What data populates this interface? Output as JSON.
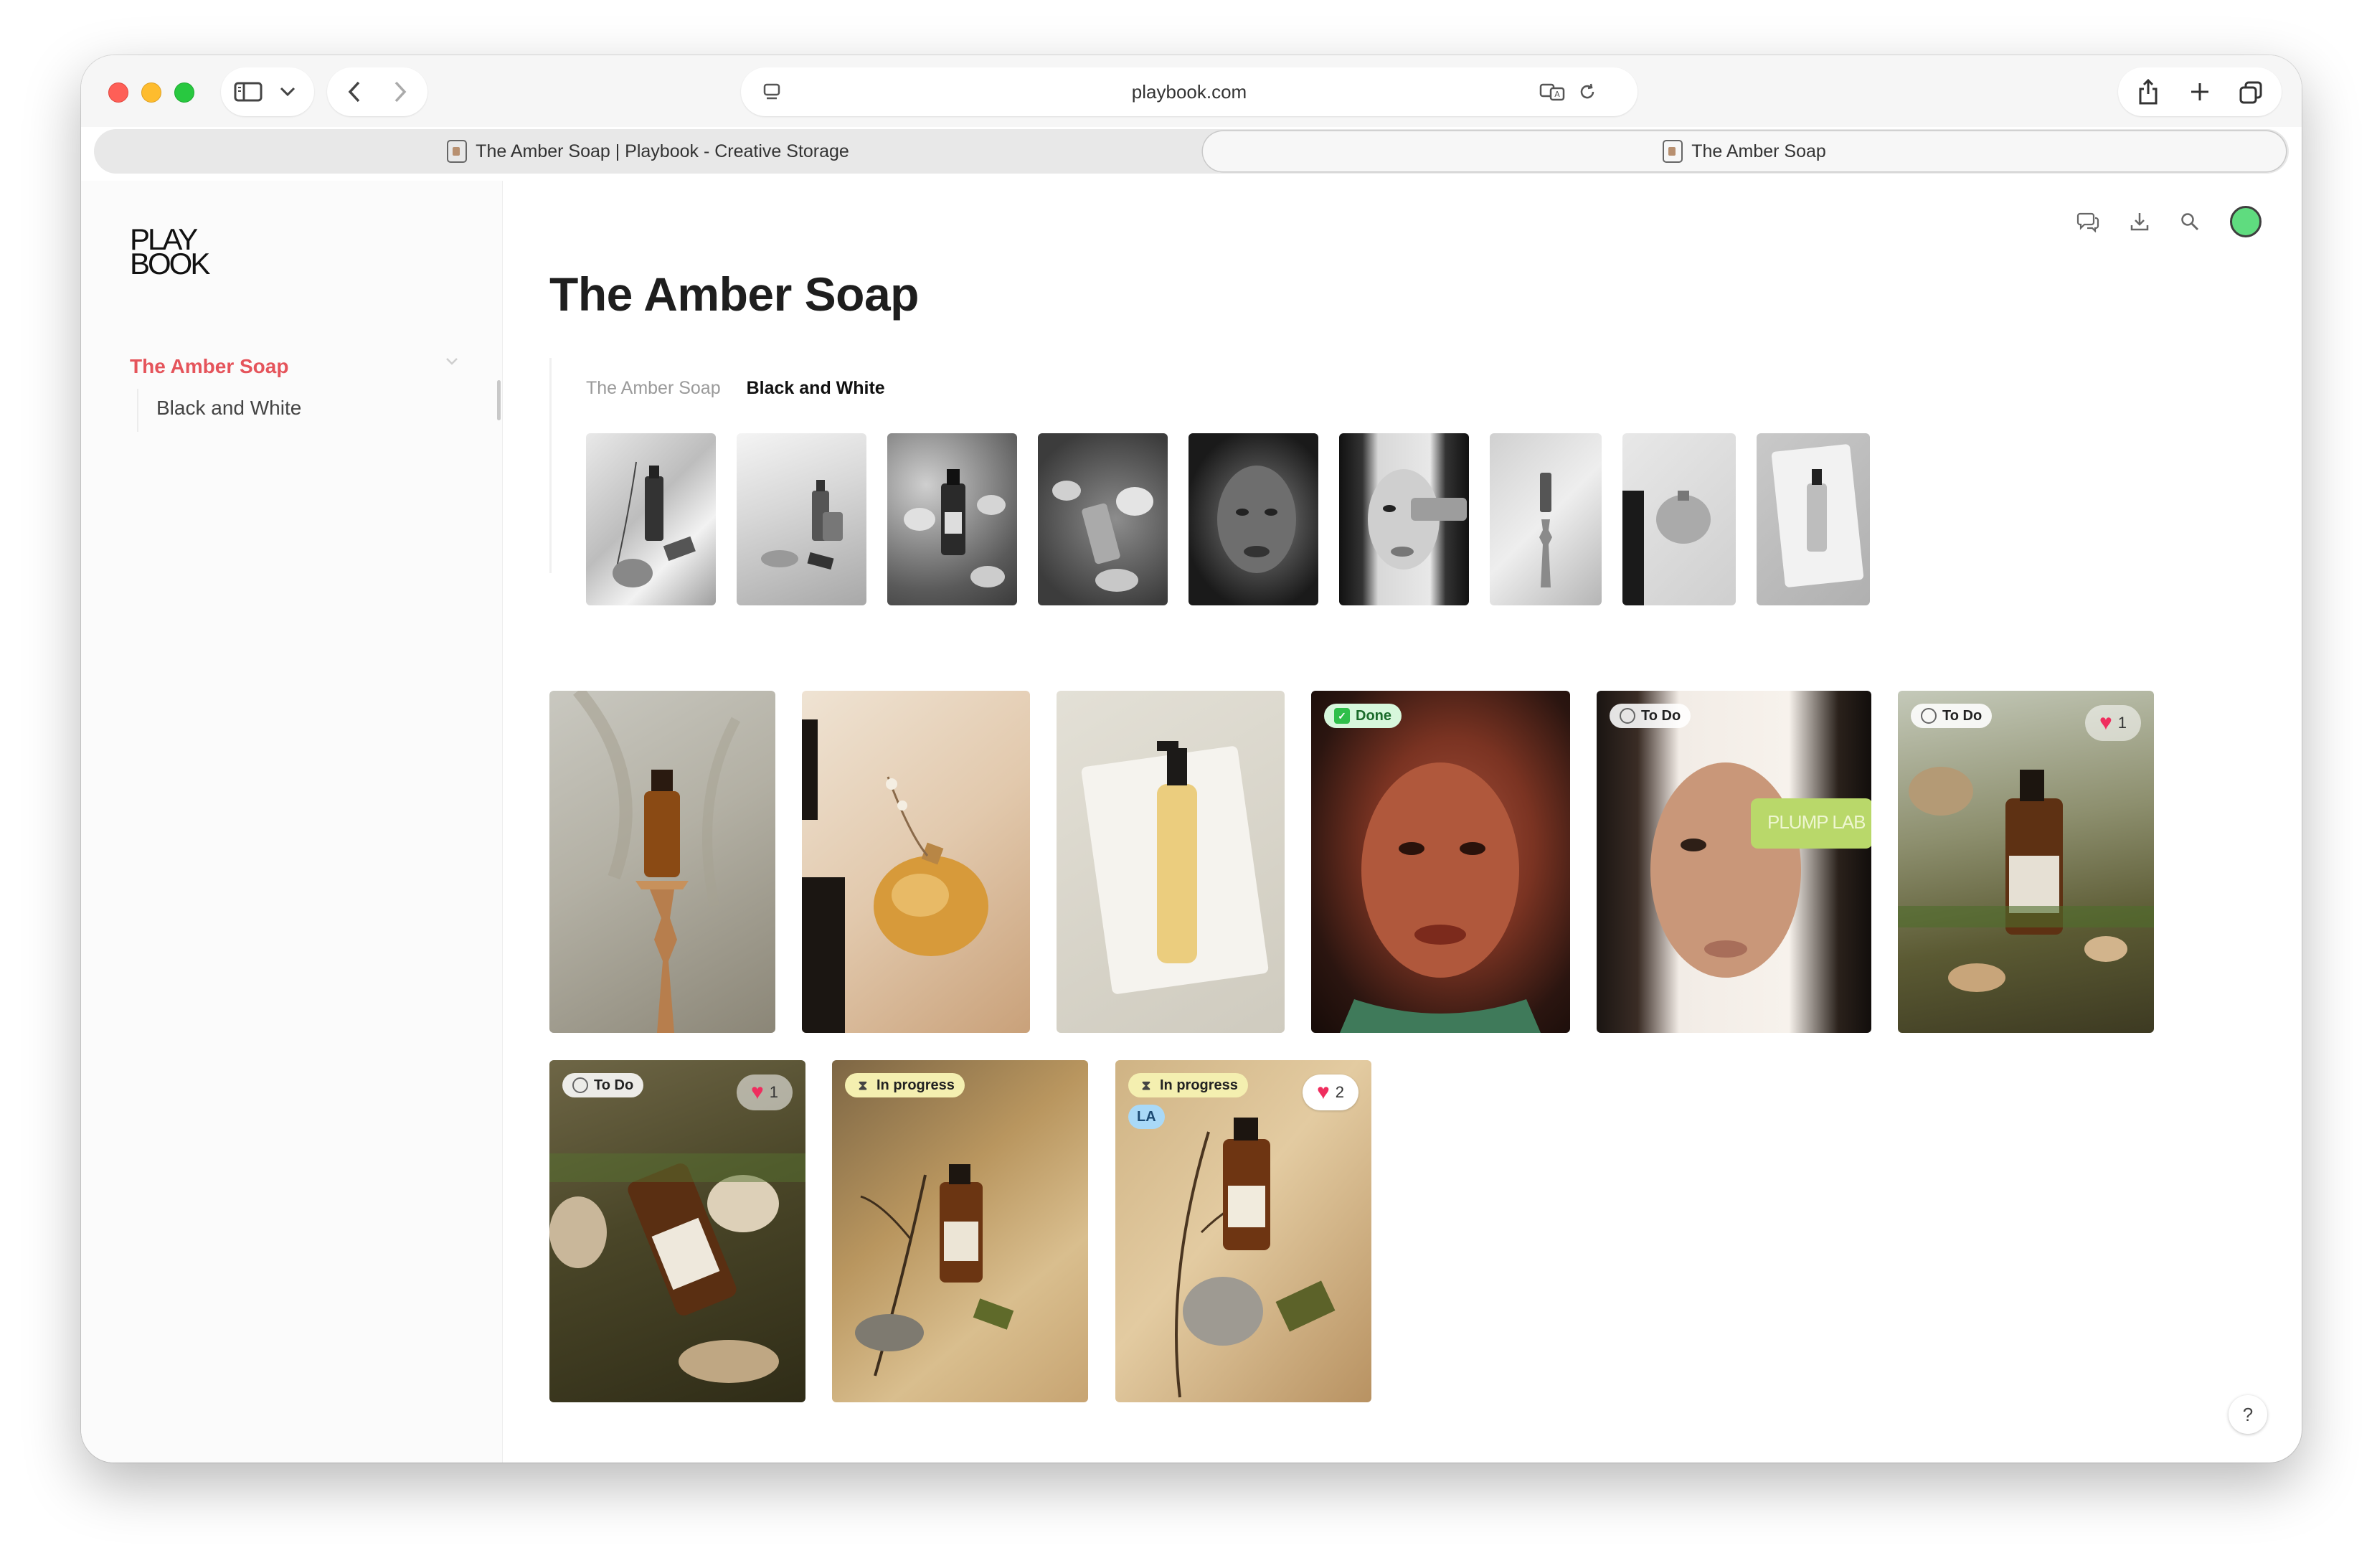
{
  "browser": {
    "url": "playbook.com",
    "tabs": [
      {
        "label": "The Amber Soap | Playbook - Creative Storage",
        "active": false
      },
      {
        "label": "The Amber Soap",
        "active": true
      }
    ]
  },
  "sidebar": {
    "logo_line1": "PLAY",
    "logo_line2": "BOOK",
    "parent": {
      "label": "The Amber Soap",
      "color": "#e5545b"
    },
    "child": {
      "label": "Black and White"
    }
  },
  "page": {
    "title": "The Amber Soap",
    "breadcrumb": {
      "parent": "The Amber Soap",
      "current": "Black and White"
    }
  },
  "strip_thumbs": [
    {
      "name": "bw-serum-branch"
    },
    {
      "name": "bw-bottles-light"
    },
    {
      "name": "bw-rocks-bottle"
    },
    {
      "name": "bw-rocks-bottle-2"
    },
    {
      "name": "bw-portrait"
    },
    {
      "name": "bw-braids-portrait"
    },
    {
      "name": "bw-pedestal"
    },
    {
      "name": "bw-perfume-magazine"
    },
    {
      "name": "bw-bottle-book"
    }
  ],
  "grid": [
    {
      "name": "serum-pedestal"
    },
    {
      "name": "perfume-magazine"
    },
    {
      "name": "salt-stone-bottle"
    },
    {
      "name": "portrait-glow",
      "status": "Done"
    },
    {
      "name": "plump-lab-portrait",
      "status": "To Do",
      "product_text": "PLUMP LAB"
    },
    {
      "name": "bottle-moss-rocks",
      "status": "To Do",
      "likes": "1"
    },
    {
      "name": "bottle-rocks-water",
      "status": "To Do",
      "likes": "1"
    },
    {
      "name": "bottle-branch-shadow",
      "status": "In progress"
    },
    {
      "name": "bottle-branch-leaf",
      "status": "In progress",
      "likes": "2",
      "initials": "LA"
    }
  ],
  "help_label": "?",
  "colors": {
    "accent": "#e5545b",
    "avatar": "#5fdc7f",
    "done_bg": "#d7f7dc",
    "progress_bg": "#f4efb0",
    "like": "#ef2d5e"
  }
}
